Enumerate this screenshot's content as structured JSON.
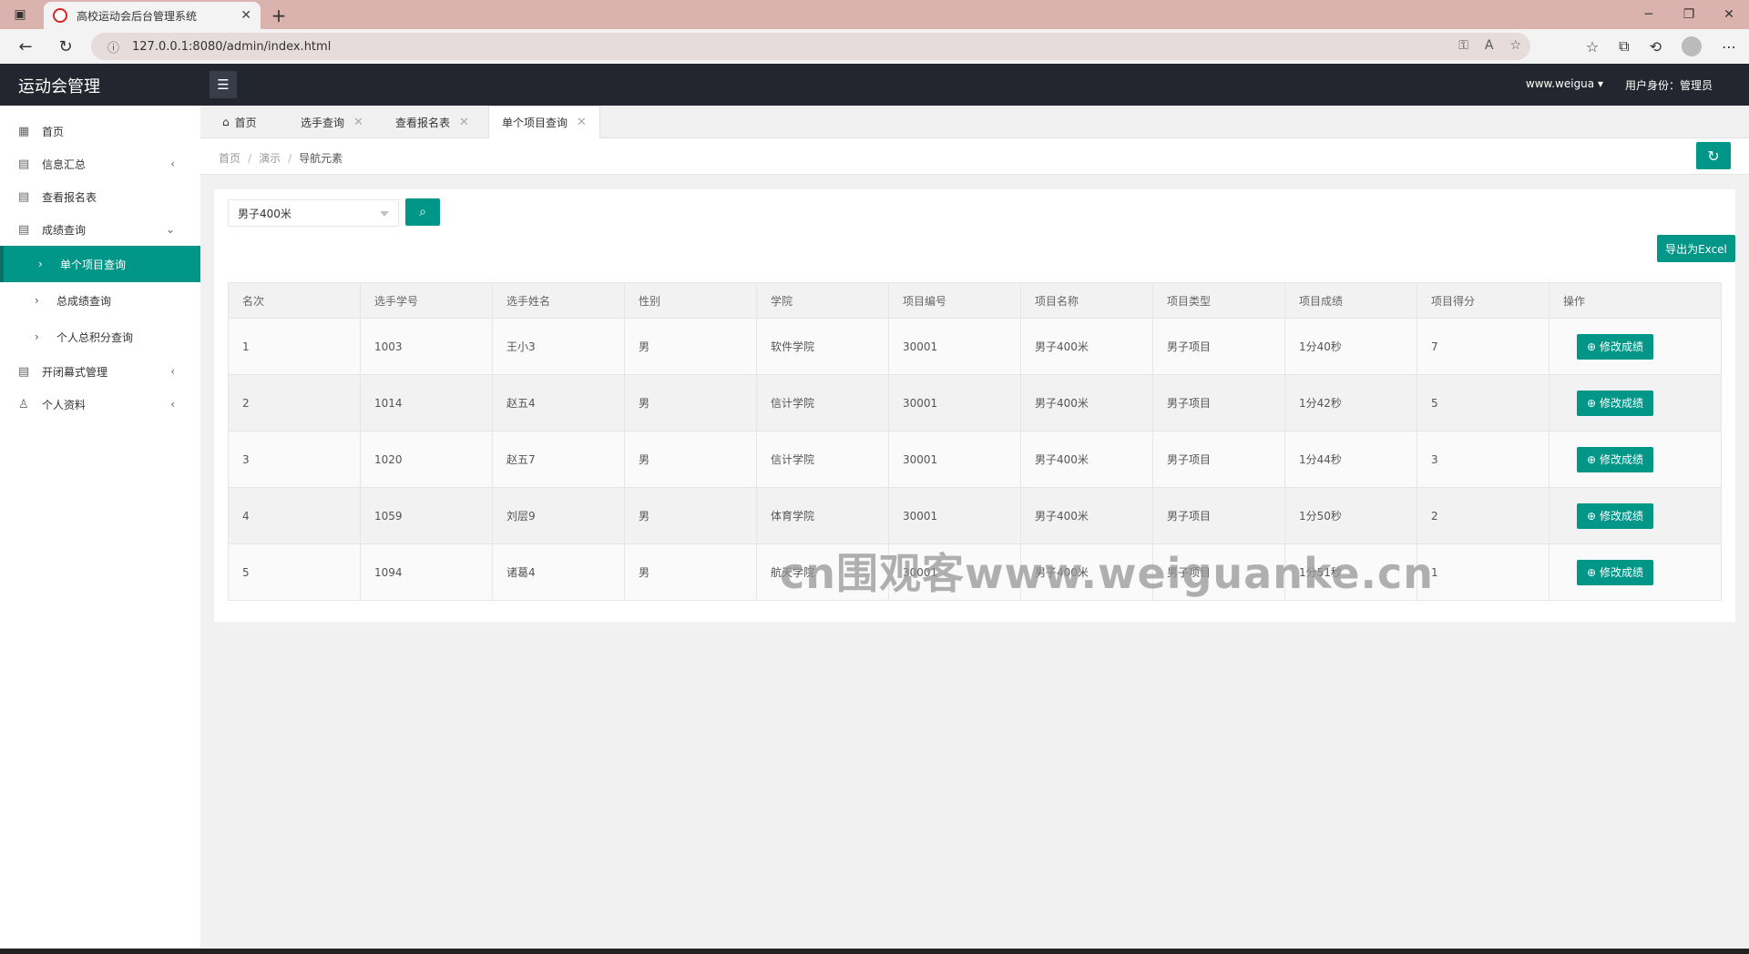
{
  "browser": {
    "tab_title": "高校运动会后台管理系统",
    "url": "127.0.0.1:8080/admin/index.html"
  },
  "header": {
    "logo": "运动会管理",
    "user": "www.weigua",
    "role": "用户身份：管理员"
  },
  "sidebar": {
    "items": [
      {
        "label": "首页"
      },
      {
        "label": "信息汇总"
      },
      {
        "label": "查看报名表"
      },
      {
        "label": "成绩查询"
      },
      {
        "label": "单个项目查询"
      },
      {
        "label": "总成绩查询"
      },
      {
        "label": "个人总积分查询"
      },
      {
        "label": "开闭幕式管理"
      },
      {
        "label": "个人资料"
      }
    ]
  },
  "tabs": [
    "首页",
    "选手查询",
    "查看报名表",
    "单个项目查询"
  ],
  "breadcrumb": [
    "首页",
    "演示",
    "导航元素"
  ],
  "filter": {
    "selected": "男子400米"
  },
  "export_label": "导出为Excel",
  "table": {
    "headers": [
      "名次",
      "选手学号",
      "选手姓名",
      "性别",
      "学院",
      "项目编号",
      "项目名称",
      "项目类型",
      "项目成绩",
      "项目得分",
      "操作"
    ],
    "rows": [
      [
        "1",
        "1003",
        "王小3",
        "男",
        "软件学院",
        "30001",
        "男子400米",
        "男子项目",
        "1分40秒",
        "7"
      ],
      [
        "2",
        "1014",
        "赵五4",
        "男",
        "信计学院",
        "30001",
        "男子400米",
        "男子项目",
        "1分42秒",
        "5"
      ],
      [
        "3",
        "1020",
        "赵五7",
        "男",
        "信计学院",
        "30001",
        "男子400米",
        "男子项目",
        "1分44秒",
        "3"
      ],
      [
        "4",
        "1059",
        "刘层9",
        "男",
        "体育学院",
        "30001",
        "男子400米",
        "男子项目",
        "1分50秒",
        "2"
      ],
      [
        "5",
        "1094",
        "诸葛4",
        "男",
        "航天学院",
        "30001",
        "男子400米",
        "男子项目",
        "1分51秒",
        "1"
      ]
    ],
    "action_label": "修改成绩"
  },
  "watermark": "cn围观客www.weiguanke.cn"
}
